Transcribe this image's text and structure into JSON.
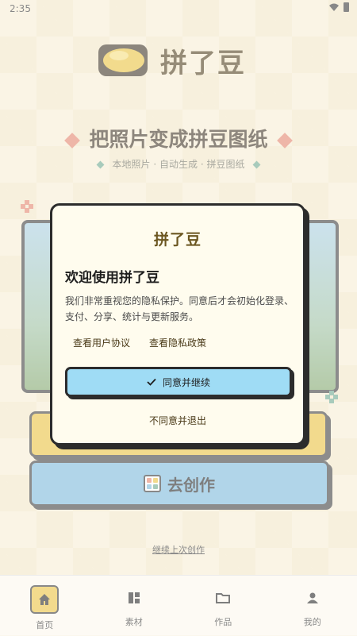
{
  "status": {
    "time": "2:35"
  },
  "app": {
    "name": "拼了豆"
  },
  "hero": {
    "tagline": "把照片变成拼豆图纸",
    "subtags": [
      "本地照片",
      "自动生成",
      "拼豆图纸"
    ],
    "sep": "·"
  },
  "actions": {
    "create_label": "去创作",
    "continue_label": "继续上次创作"
  },
  "tabs": [
    {
      "label": "首页",
      "icon": "home-icon",
      "active": true
    },
    {
      "label": "素材",
      "icon": "material-icon",
      "active": false
    },
    {
      "label": "作品",
      "icon": "folder-icon",
      "active": false
    },
    {
      "label": "我的",
      "icon": "user-icon",
      "active": false
    }
  ],
  "dialog": {
    "brand": "拼了豆",
    "title": "欢迎使用拼了豆",
    "body": "我们非常重视您的隐私保护。同意后才会初始化登录、支付、分享、统计与更新服务。",
    "link_user_agreement": "查看用户协议",
    "link_privacy": "查看隐私政策",
    "agree_label": "同意并继续",
    "decline_label": "不同意并退出"
  },
  "colors": {
    "accent_yellow": "#e8bf3c",
    "accent_blue": "#79b7d9",
    "agree_blue": "#9fdcf5",
    "brand_text": "#6b5620"
  }
}
